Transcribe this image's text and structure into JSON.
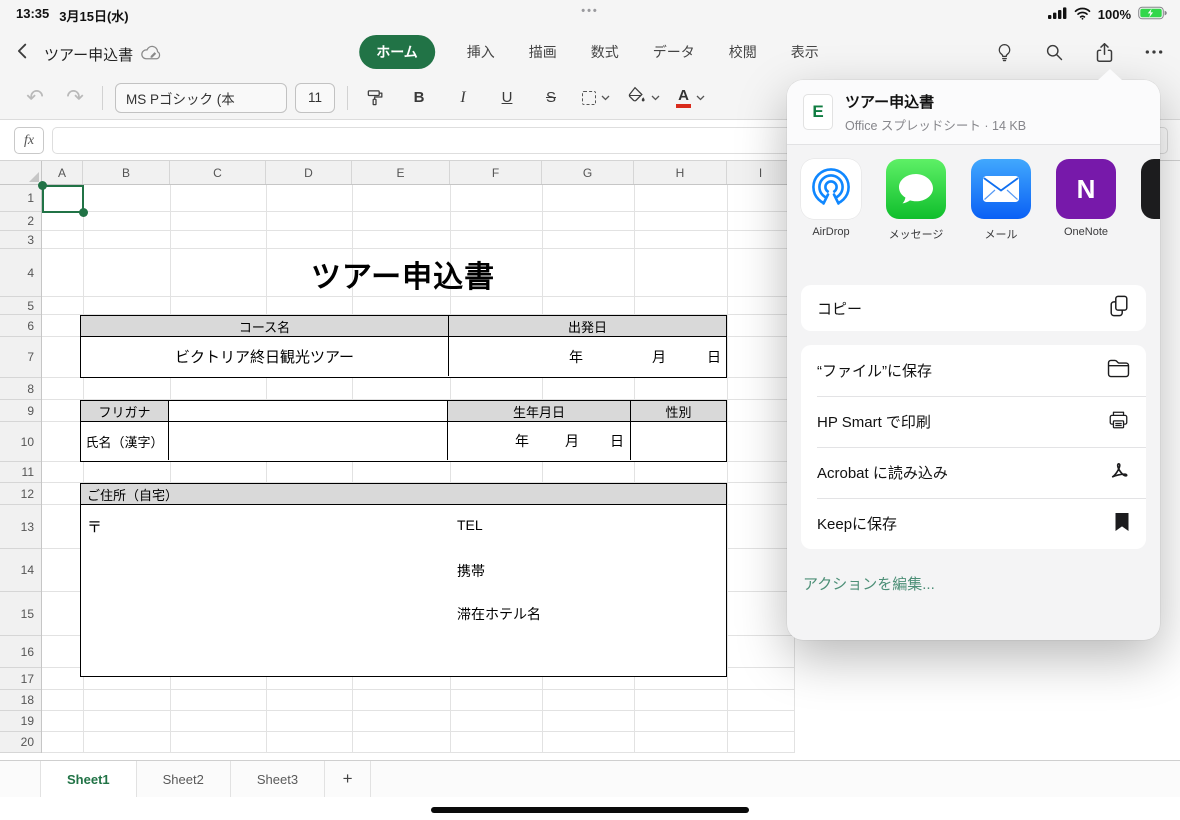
{
  "status_bar": {
    "time": "13:35",
    "date": "3月15日(水)",
    "battery_percent": "100%"
  },
  "navbar": {
    "document_title": "ツアー申込書",
    "tabs": [
      "ホーム",
      "挿入",
      "描画",
      "数式",
      "データ",
      "校閲",
      "表示"
    ]
  },
  "format_bar": {
    "font_name": "MS Pゴシック (本",
    "font_size": "11",
    "bold": "B",
    "italic": "I",
    "underline": "U",
    "strikethrough": "S"
  },
  "formula_bar": {
    "fx_label": "fx",
    "value": ""
  },
  "grid": {
    "columns": [
      "A",
      "B",
      "C",
      "D",
      "E",
      "F",
      "G",
      "H",
      "I"
    ],
    "rows": [
      "1",
      "2",
      "3",
      "4",
      "5",
      "6",
      "7",
      "8",
      "9",
      "10",
      "11",
      "12",
      "13",
      "14",
      "15",
      "16",
      "17",
      "18",
      "19",
      "20"
    ],
    "doc_title": "ツアー申込書",
    "table_course": {
      "col1_header": "コース名",
      "col2_header": "出発日",
      "course_name": "ビクトリア終日観光ツアー",
      "year": "年",
      "month": "月",
      "day": "日"
    },
    "table_person": {
      "furigana": "フリガナ",
      "dob": "生年月日",
      "gender": "性別",
      "name": "氏名（漢字）",
      "year": "年",
      "month": "月",
      "day": "日"
    },
    "table_address": {
      "header": "ご住所（自宅）",
      "postal": "〒",
      "tel": "TEL",
      "mobile": "携帯",
      "hotel": "滞在ホテル名"
    }
  },
  "sheet_tabs": {
    "tabs": [
      "Sheet1",
      "Sheet2",
      "Sheet3"
    ],
    "add_label": "+"
  },
  "share_sheet": {
    "file_title": "ツアー申込書",
    "file_meta": "Office スプレッドシート · 14 KB",
    "icon_letters": {
      "excel": "E",
      "onenote": "N"
    },
    "apps": [
      "AirDrop",
      "メッセージ",
      "メール",
      "OneNote"
    ],
    "copy_label": "コピー",
    "actions": [
      "“ファイル”に保存",
      "HP Smart で印刷",
      "Acrobat に読み込み",
      "Keepに保存"
    ],
    "edit_actions_label": "アクションを編集..."
  }
}
